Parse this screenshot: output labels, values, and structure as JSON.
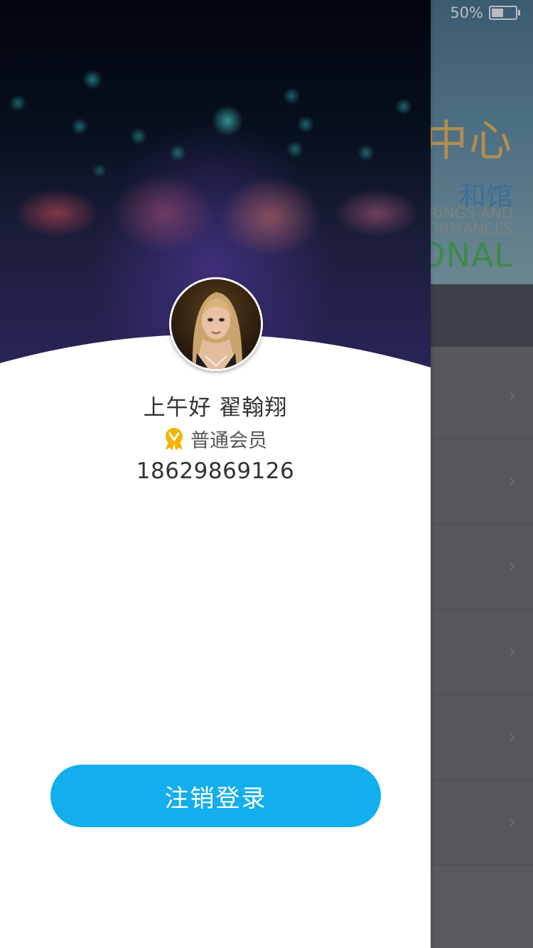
{
  "status_bar": {
    "battery_percent": "50%",
    "battery_level": 0.5
  },
  "background_banner": {
    "line1": "中心",
    "line2": "和馆",
    "line3": "RINGS AND",
    "line4": "ORMANCES",
    "line5": "ONAL"
  },
  "drawer": {
    "greeting": "上午好  翟翰翔",
    "member_level": "普通会员",
    "phone": "18629869126",
    "logout_label": "注销登录"
  },
  "colors": {
    "primary_button": "#12aeee",
    "member_badge": "#f5b400"
  }
}
